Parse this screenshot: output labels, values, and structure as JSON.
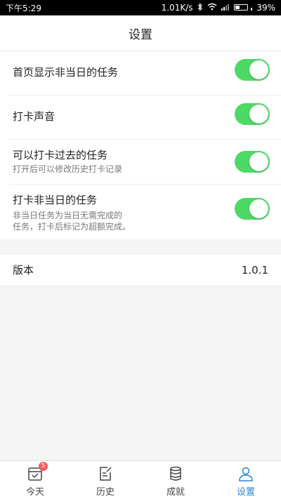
{
  "status_bar": {
    "time": "下午5:29",
    "network_speed": "1.01K/s",
    "battery_percent": "39%",
    "battery_level": 0.39
  },
  "nav": {
    "title": "设置"
  },
  "settings": [
    {
      "title": "首页显示非当日的任务",
      "desc": "",
      "enabled": true
    },
    {
      "title": "打卡声音",
      "desc": "",
      "enabled": true
    },
    {
      "title": "可以打卡过去的任务",
      "desc": "打开后可以修改历史打卡记录",
      "enabled": true
    },
    {
      "title": "打卡非当日的任务",
      "desc_lines": [
        "非当日任务为当日无需完成的",
        "任务，打卡后标记为超额完成。"
      ],
      "enabled": true
    }
  ],
  "version": {
    "label": "版本",
    "value": "1.0.1"
  },
  "tabs": [
    {
      "label": "今天",
      "icon": "calendar-check-icon",
      "badge": "5",
      "active": false
    },
    {
      "label": "历史",
      "icon": "edit-note-icon",
      "active": false
    },
    {
      "label": "成就",
      "icon": "coin-stack-icon",
      "active": false
    },
    {
      "label": "设置",
      "icon": "user-icon",
      "active": true
    }
  ],
  "colors": {
    "switch_on": "#4cd964",
    "accent": "#2a85d8",
    "badge": "#f25c5c"
  }
}
